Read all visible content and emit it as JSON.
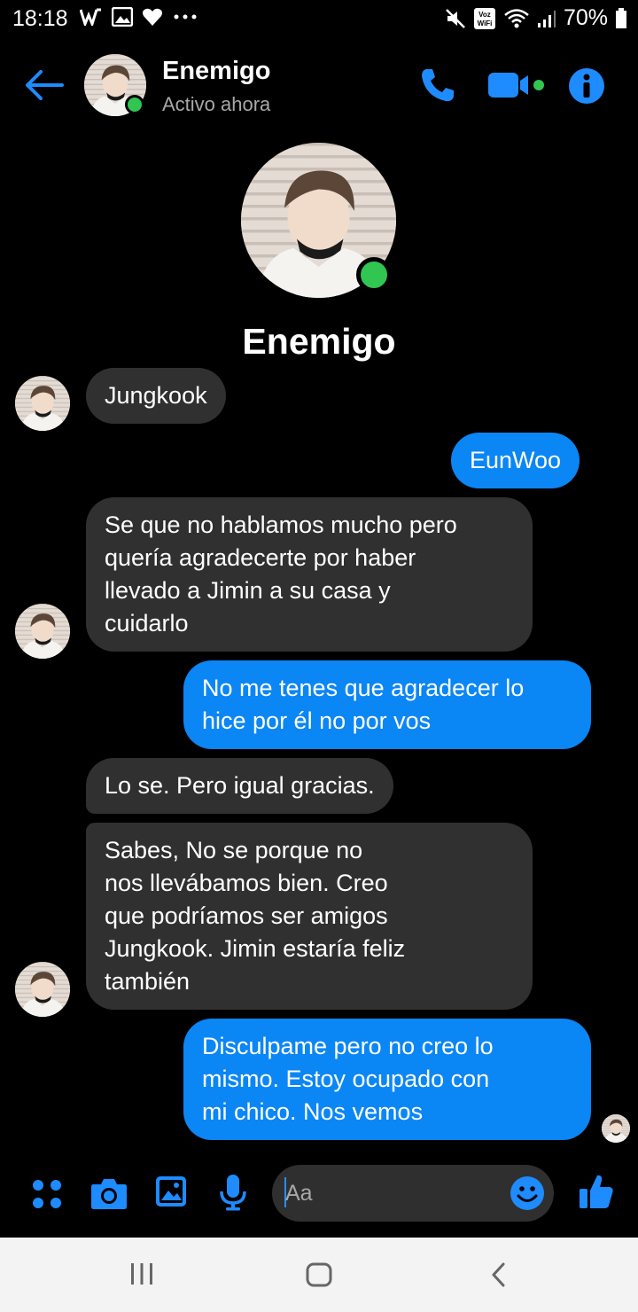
{
  "status_bar": {
    "time": "18:18",
    "battery": "70%",
    "left_icons": [
      "w-icon",
      "image-icon",
      "heart-icon",
      "more-dots-icon"
    ],
    "right_icons": [
      "mute-icon",
      "volte-wifi-icon",
      "wifi-icon",
      "signal-icon",
      "battery-icon"
    ]
  },
  "header": {
    "name": "Enemigo",
    "status": "Activo ahora"
  },
  "profile": {
    "name": "Enemigo"
  },
  "messages": [
    {
      "from": "them",
      "text": "Jungkook"
    },
    {
      "from": "me",
      "text": "EunWoo"
    },
    {
      "from": "them",
      "text": "Se que no hablamos mucho pero\nquería agradecerte por haber\nllevado a Jimin a su casa y\ncuidarlo"
    },
    {
      "from": "me",
      "text": "No me tenes que agradecer lo\nhice por él no por vos"
    },
    {
      "from": "them",
      "text": "Lo se. Pero igual gracias."
    },
    {
      "from": "them",
      "text": "Sabes, No se porque no\nnos llevábamos bien. Creo\nque podríamos ser amigos\nJungkook. Jimin estaría feliz\ntambién"
    },
    {
      "from": "me",
      "text": "Disculpame pero no creo lo\nmismo. Estoy ocupado con\nmi chico. Nos vemos"
    }
  ],
  "composer": {
    "placeholder": "Aa"
  },
  "colors": {
    "accent": "#0b86f5",
    "incoming_bubble": "#303030",
    "online": "#31c552",
    "background": "#000000"
  }
}
